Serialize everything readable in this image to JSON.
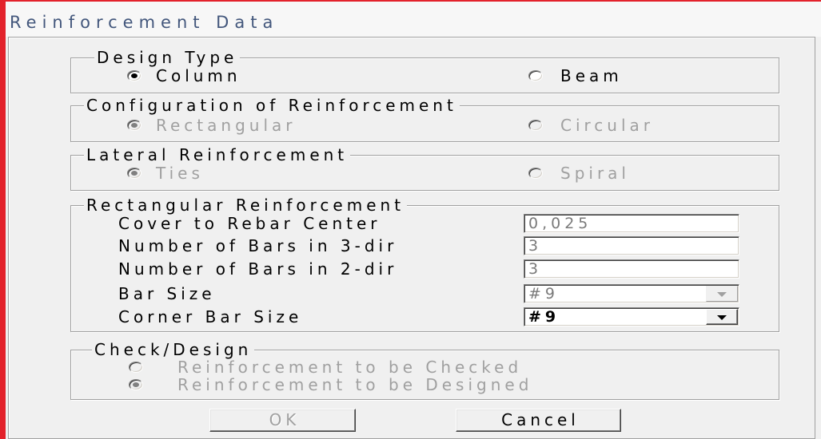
{
  "window": {
    "title": "Reinforcement Data"
  },
  "design_type": {
    "label": "Design Type",
    "enabled": true,
    "options": [
      {
        "label": "Column",
        "selected": true
      },
      {
        "label": "Beam",
        "selected": false
      }
    ]
  },
  "configuration": {
    "label": "Configuration of Reinforcement",
    "enabled": false,
    "options": [
      {
        "label": "Rectangular",
        "selected": true
      },
      {
        "label": "Circular",
        "selected": false
      }
    ]
  },
  "lateral": {
    "label": "Lateral Reinforcement",
    "enabled": false,
    "options": [
      {
        "label": "Ties",
        "selected": true
      },
      {
        "label": "Spiral",
        "selected": false
      }
    ]
  },
  "rectangular": {
    "label": "Rectangular Reinforcement",
    "cover": {
      "label": "Cover to Rebar Center",
      "value": "0,025"
    },
    "bars_3dir": {
      "label": "Number of Bars in 3-dir",
      "value": "3"
    },
    "bars_2dir": {
      "label": "Number of Bars in 2-dir",
      "value": "3"
    },
    "bar_size": {
      "label": "Bar Size",
      "value": "#9",
      "enabled": false
    },
    "corner_bar_size": {
      "label": "Corner Bar Size",
      "value": "#9",
      "enabled": true
    }
  },
  "check_design": {
    "label": "Check/Design",
    "enabled": false,
    "options": [
      {
        "label": "Reinforcement to be Checked",
        "selected": false
      },
      {
        "label": "Reinforcement to be Designed",
        "selected": true
      }
    ]
  },
  "buttons": {
    "ok": {
      "label": "OK",
      "enabled": false
    },
    "cancel": {
      "label": "Cancel",
      "enabled": true
    }
  },
  "icons": {
    "radio": "radio-button-icon",
    "dropdown": "chevron-down-icon"
  },
  "colors": {
    "frame": "#e3222b",
    "face": "#f0f0f0",
    "title_text": "#43577c",
    "disabled_text": "#a0a0a0"
  }
}
